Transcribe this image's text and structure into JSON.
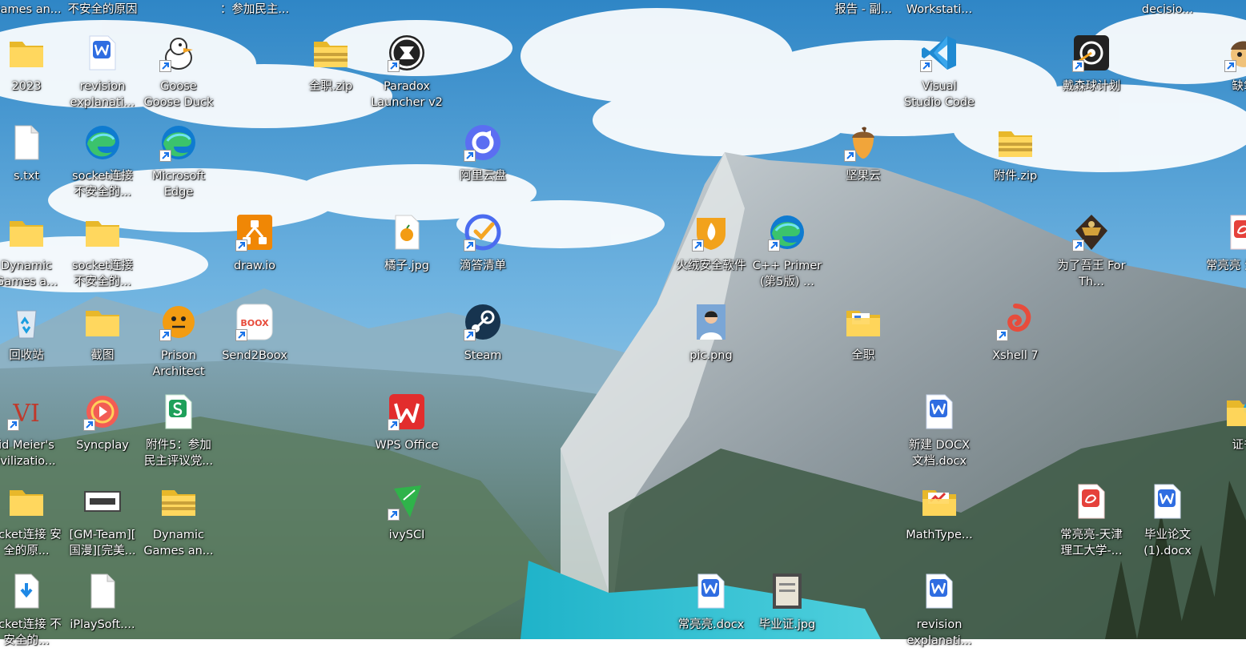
{
  "top_labels": [
    {
      "col": 0,
      "text": "Games an..."
    },
    {
      "col": 1,
      "text": "不安全的原因"
    },
    {
      "col": 3,
      "text": "：参加民主..."
    },
    {
      "col": 11,
      "text": "报告 - 副..."
    },
    {
      "col": 12,
      "text": "Workstati..."
    },
    {
      "col": 15,
      "text": "decisio..."
    }
  ],
  "icons": [
    {
      "id": "2023",
      "label": "2023",
      "type": "folder",
      "col": 0,
      "row": 0,
      "shortcut": false
    },
    {
      "id": "revision-docx",
      "label": "revision explanati...",
      "type": "wps-word",
      "col": 1,
      "row": 0,
      "shortcut": false
    },
    {
      "id": "goose-goose-duck",
      "label": "Goose Goose Duck",
      "type": "goose",
      "col": 2,
      "row": 0,
      "shortcut": true
    },
    {
      "id": "quanzhi-zip",
      "label": "全职.zip",
      "type": "zip",
      "col": 4,
      "row": 0,
      "shortcut": false
    },
    {
      "id": "paradox-launcher",
      "label": "Paradox Launcher v2",
      "type": "paradox",
      "col": 5,
      "row": 0,
      "shortcut": true
    },
    {
      "id": "vscode",
      "label": "Visual Studio Code",
      "type": "vscode",
      "col": 12,
      "row": 0,
      "shortcut": true
    },
    {
      "id": "dyson-sphere",
      "label": "戴森球计划",
      "type": "dyson",
      "col": 14,
      "row": 0,
      "shortcut": true
    },
    {
      "id": "partial-app",
      "label": "缺氧",
      "type": "oni",
      "col": 16,
      "row": 0,
      "shortcut": true
    },
    {
      "id": "s-txt",
      "label": "s.txt",
      "type": "file",
      "col": 0,
      "row": 1,
      "shortcut": false
    },
    {
      "id": "socket-edge",
      "label": "socket连接 不安全的...",
      "type": "edge",
      "col": 1,
      "row": 1,
      "shortcut": false
    },
    {
      "id": "ms-edge",
      "label": "Microsoft Edge",
      "type": "edge",
      "col": 2,
      "row": 1,
      "shortcut": true
    },
    {
      "id": "aliyun-drive",
      "label": "阿里云盘",
      "type": "aliyun",
      "col": 6,
      "row": 1,
      "shortcut": true
    },
    {
      "id": "jianguoyun",
      "label": "坚果云",
      "type": "acorn",
      "col": 11,
      "row": 1,
      "shortcut": true
    },
    {
      "id": "fujian-zip",
      "label": "附件.zip",
      "type": "zip",
      "col": 13,
      "row": 1,
      "shortcut": false
    },
    {
      "id": "dynamic-games-folder",
      "label": "Dynamic Games a...",
      "type": "folder",
      "col": 0,
      "row": 2,
      "shortcut": false
    },
    {
      "id": "socket-folder",
      "label": "socket连接 不安全的...",
      "type": "folder",
      "col": 1,
      "row": 2,
      "shortcut": false
    },
    {
      "id": "drawio",
      "label": "draw.io",
      "type": "drawio",
      "col": 3,
      "row": 2,
      "shortcut": true
    },
    {
      "id": "juzi-jpg",
      "label": "橘子.jpg",
      "type": "image-orange",
      "col": 5,
      "row": 2,
      "shortcut": false
    },
    {
      "id": "didaqingdan",
      "label": "滴答清单",
      "type": "ticktick",
      "col": 6,
      "row": 2,
      "shortcut": true
    },
    {
      "id": "huorong",
      "label": "火绒安全软件",
      "type": "huorong",
      "col": 9,
      "row": 2,
      "shortcut": true
    },
    {
      "id": "cpp-primer",
      "label": "C++ Primer (第5版) ...",
      "type": "edge",
      "col": 10,
      "row": 2,
      "shortcut": true
    },
    {
      "id": "weile-wuwang",
      "label": "为了吾王 For Th...",
      "type": "forking",
      "col": 14,
      "row": 2,
      "shortcut": true
    },
    {
      "id": "changliangliang-pdf",
      "label": "常亮亮 生成绩...",
      "type": "wps-pdf",
      "col": 16,
      "row": 2,
      "shortcut": false
    },
    {
      "id": "recycle-bin",
      "label": "回收站",
      "type": "recycle",
      "col": 0,
      "row": 3,
      "shortcut": false
    },
    {
      "id": "jietu",
      "label": "截图",
      "type": "folder",
      "col": 1,
      "row": 3,
      "shortcut": false
    },
    {
      "id": "prison-architect",
      "label": "Prison Architect",
      "type": "prison",
      "col": 2,
      "row": 3,
      "shortcut": true
    },
    {
      "id": "send2boox",
      "label": "Send2Boox",
      "type": "boox",
      "col": 3,
      "row": 3,
      "shortcut": true
    },
    {
      "id": "steam",
      "label": "Steam",
      "type": "steam",
      "col": 6,
      "row": 3,
      "shortcut": true
    },
    {
      "id": "pic-png",
      "label": "pic.png",
      "type": "photo",
      "col": 9,
      "row": 3,
      "shortcut": false
    },
    {
      "id": "quanzhi-folder",
      "label": "全职",
      "type": "folder-doc",
      "col": 11,
      "row": 3,
      "shortcut": false
    },
    {
      "id": "xshell",
      "label": "Xshell 7",
      "type": "xshell",
      "col": 13,
      "row": 3,
      "shortcut": true
    },
    {
      "id": "civilization",
      "label": "id Meier's ivilizatio...",
      "type": "civ",
      "col": 0,
      "row": 4,
      "shortcut": true
    },
    {
      "id": "syncplay",
      "label": "Syncplay",
      "type": "syncplay",
      "col": 1,
      "row": 4,
      "shortcut": true
    },
    {
      "id": "fujian5",
      "label": "附件5：参加 民主评议党...",
      "type": "wps-sheet",
      "col": 2,
      "row": 4,
      "shortcut": false
    },
    {
      "id": "wps-office",
      "label": "WPS Office",
      "type": "wps",
      "col": 5,
      "row": 4,
      "shortcut": true
    },
    {
      "id": "new-docx",
      "label": "新建 DOCX 文档.docx",
      "type": "wps-word",
      "col": 12,
      "row": 4,
      "shortcut": false
    },
    {
      "id": "zhengshu",
      "label": "证书",
      "type": "folder-edge",
      "col": 16,
      "row": 4,
      "shortcut": false
    },
    {
      "id": "socket-folder2",
      "label": "ocket连接 安全的原...",
      "type": "folder",
      "col": 0,
      "row": 5,
      "shortcut": false
    },
    {
      "id": "gm-team",
      "label": "[GM-Team][ 国漫][完美...",
      "type": "video-thumb",
      "col": 1,
      "row": 5,
      "shortcut": false
    },
    {
      "id": "dynamic-games-zip",
      "label": "Dynamic Games an...",
      "type": "zip",
      "col": 2,
      "row": 5,
      "shortcut": false
    },
    {
      "id": "ivysci",
      "label": "ivySCI",
      "type": "ivysci",
      "col": 5,
      "row": 5,
      "shortcut": true
    },
    {
      "id": "mathtype",
      "label": "MathType...",
      "type": "folder-red",
      "col": 12,
      "row": 5,
      "shortcut": false
    },
    {
      "id": "tianjin-pdf",
      "label": "常亮亮-天津 理工大学-...",
      "type": "wps-pdf",
      "col": 14,
      "row": 5,
      "shortcut": false
    },
    {
      "id": "biye-lunwen",
      "label": "毕业论文 (1).docx",
      "type": "wps-word",
      "col": 15,
      "row": 5,
      "shortcut": false
    },
    {
      "id": "socket-install",
      "label": "ocket连接 不安全的...",
      "type": "installer",
      "col": 0,
      "row": 6,
      "shortcut": false
    },
    {
      "id": "iplaysoft",
      "label": "iPlaySoft....",
      "type": "file",
      "col": 1,
      "row": 6,
      "shortcut": false
    },
    {
      "id": "changliangliang-docx",
      "label": "常亮亮.docx",
      "type": "wps-word",
      "col": 9,
      "row": 6,
      "shortcut": false
    },
    {
      "id": "biyezheng-jpg",
      "label": "毕业证.jpg",
      "type": "cert-img",
      "col": 10,
      "row": 6,
      "shortcut": false
    },
    {
      "id": "revision-docx2",
      "label": "revision explanati...",
      "type": "wps-word",
      "col": 12,
      "row": 6,
      "shortcut": false
    }
  ]
}
